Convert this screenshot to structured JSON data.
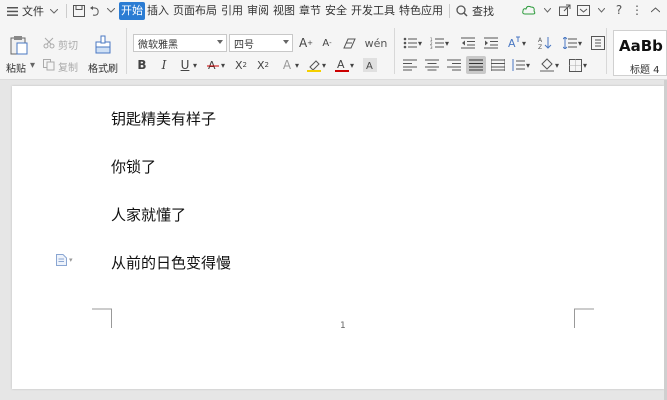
{
  "menubar": {
    "file_label": "文件",
    "tabs": [
      {
        "label": "开始",
        "active": true
      },
      {
        "label": "插入",
        "active": false
      },
      {
        "label": "页面布局",
        "active": false
      },
      {
        "label": "引用",
        "active": false
      },
      {
        "label": "审阅",
        "active": false
      },
      {
        "label": "视图",
        "active": false
      },
      {
        "label": "章节",
        "active": false
      },
      {
        "label": "安全",
        "active": false
      },
      {
        "label": "开发工具",
        "active": false
      },
      {
        "label": "特色应用",
        "active": false
      }
    ],
    "search_label": "查找"
  },
  "ribbon": {
    "paste_label": "粘贴",
    "cut_label": "剪切",
    "copy_label": "复制",
    "format_painter_label": "格式刷",
    "font_name": "微软雅黑",
    "font_size": "四号",
    "style_preview": "AaBb",
    "style_name": "标题 4"
  },
  "document": {
    "paragraphs": [
      "钥匙精美有样子",
      "你锁了",
      "人家就懂了",
      "从前的日色变得慢"
    ],
    "page_number": "1"
  },
  "colors": {
    "accent": "#2b7cd3",
    "font_color": "#cc0000",
    "highlight": "#f5d000"
  }
}
